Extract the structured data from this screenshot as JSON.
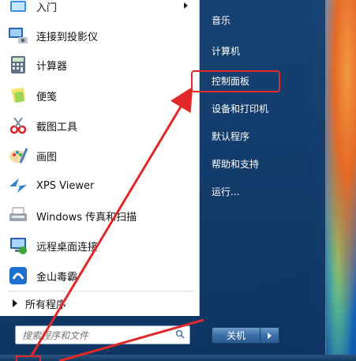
{
  "programs": [
    {
      "label": "入门",
      "icon": "getting-started-icon",
      "has_submenu": true
    },
    {
      "label": "连接到投影仪",
      "icon": "projector-icon"
    },
    {
      "label": "计算器",
      "icon": "calculator-icon"
    },
    {
      "label": "便笺",
      "icon": "sticky-notes-icon"
    },
    {
      "label": "截图工具",
      "icon": "snipping-tool-icon"
    },
    {
      "label": "画图",
      "icon": "paint-icon"
    },
    {
      "label": "XPS Viewer",
      "icon": "xps-viewer-icon"
    },
    {
      "label": "Windows 传真和扫描",
      "icon": "fax-scan-icon"
    },
    {
      "label": "远程桌面连接",
      "icon": "remote-desktop-icon"
    },
    {
      "label": "金山毒霸",
      "icon": "antivirus-icon"
    }
  ],
  "all_programs_label": "所有程序",
  "search": {
    "placeholder": "搜索程序和文件"
  },
  "right_items": [
    {
      "label": "音乐"
    },
    {
      "label": "计算机"
    },
    {
      "label": "控制面板"
    },
    {
      "label": "设备和打印机"
    },
    {
      "label": "默认程序"
    },
    {
      "label": "帮助和支持"
    },
    {
      "label": "运行..."
    }
  ],
  "shutdown_label": "关机",
  "colors": {
    "annotation_red": "#e3282a",
    "start_menu_blue": "#143c69"
  }
}
